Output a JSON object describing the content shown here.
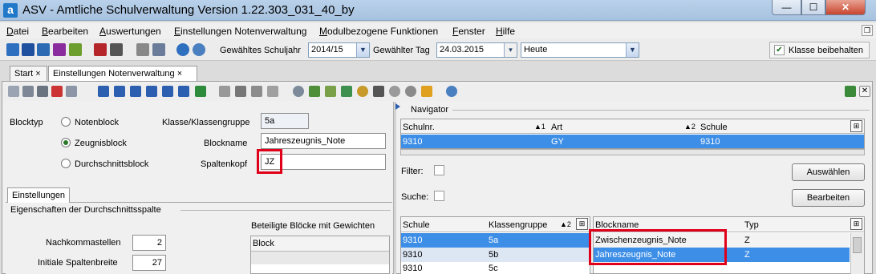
{
  "window": {
    "title": "ASV - Amtliche Schulverwaltung Version 1.22.303_031_40_by",
    "app_icon": "a",
    "icons": {
      "minimize": "minimize-icon",
      "maximize": "maximize-icon",
      "close": "close-icon"
    }
  },
  "menu": [
    "Datei",
    "Bearbeiten",
    "Auswertungen",
    "Einstellungen Notenverwaltung",
    "Modulbezogene Funktionen",
    "Fenster",
    "Hilfe"
  ],
  "toolbar": {
    "schuljahr_label": "Gewähltes Schuljahr",
    "schuljahr_value": "2014/15",
    "tag_label": "Gewählter Tag",
    "tag_value": "24.03.2015",
    "heute_value": "Heute",
    "klasse_beibehalten_label": "Klasse beibehalten",
    "klasse_beibehalten_checked": true
  },
  "tabs": [
    {
      "label": "Start",
      "close": "×"
    },
    {
      "label": "Einstellungen Notenverwaltung",
      "close": "×"
    }
  ],
  "form": {
    "blocktyp_label": "Blocktyp",
    "radio_options": [
      "Notenblock",
      "Zeugnisblock",
      "Durchschnittsblock"
    ],
    "selected_radio": "Zeugnisblock",
    "klasse_label": "Klasse/Klassengruppe",
    "klasse_value": "5a",
    "blockname_label": "Blockname",
    "blockname_value": "Jahreszeugnis_Note",
    "spaltenkopf_label": "Spaltenkopf",
    "spaltenkopf_value": "JZ"
  },
  "settings": {
    "tab_label": "Einstellungen",
    "group_title": "Eigenschaften der Durchschnittsspalte",
    "nachkommastellen_label": "Nachkommastellen",
    "nachkommastellen_value": "2",
    "spaltenbreite_label": "Initiale Spaltenbreite",
    "spaltenbreite_value": "27",
    "beteiligte_title": "Beteiligte Blöcke mit Gewichten",
    "block_col": "Block"
  },
  "navigator": {
    "title": "Navigator",
    "columns": [
      "Schulnr.",
      "Art",
      "Schule"
    ],
    "sort_markers": [
      "▲1",
      "▲2"
    ],
    "row": [
      "9310",
      "GY",
      "9310"
    ],
    "filter_label": "Filter:",
    "suche_label": "Suche:",
    "auswaehlen_button": "Auswählen",
    "bearbeiten_button": "Bearbeiten"
  },
  "class_table": {
    "columns": [
      "Schule",
      "Klassengruppe"
    ],
    "sort_marker": "▲2",
    "rows": [
      [
        "9310",
        "5a"
      ],
      [
        "9310",
        "5b"
      ],
      [
        "9310",
        "5c"
      ]
    ]
  },
  "block_table": {
    "columns": [
      "Blockname",
      "Typ"
    ],
    "rows": [
      [
        "Zwischenzeugnis_Note",
        "Z"
      ],
      [
        "Jahreszeugnis_Note",
        "Z"
      ]
    ]
  },
  "colors": {
    "selection": "#3d8ee6",
    "highlight_box": "#e0001a",
    "title_bar": "#b9d1ea"
  }
}
